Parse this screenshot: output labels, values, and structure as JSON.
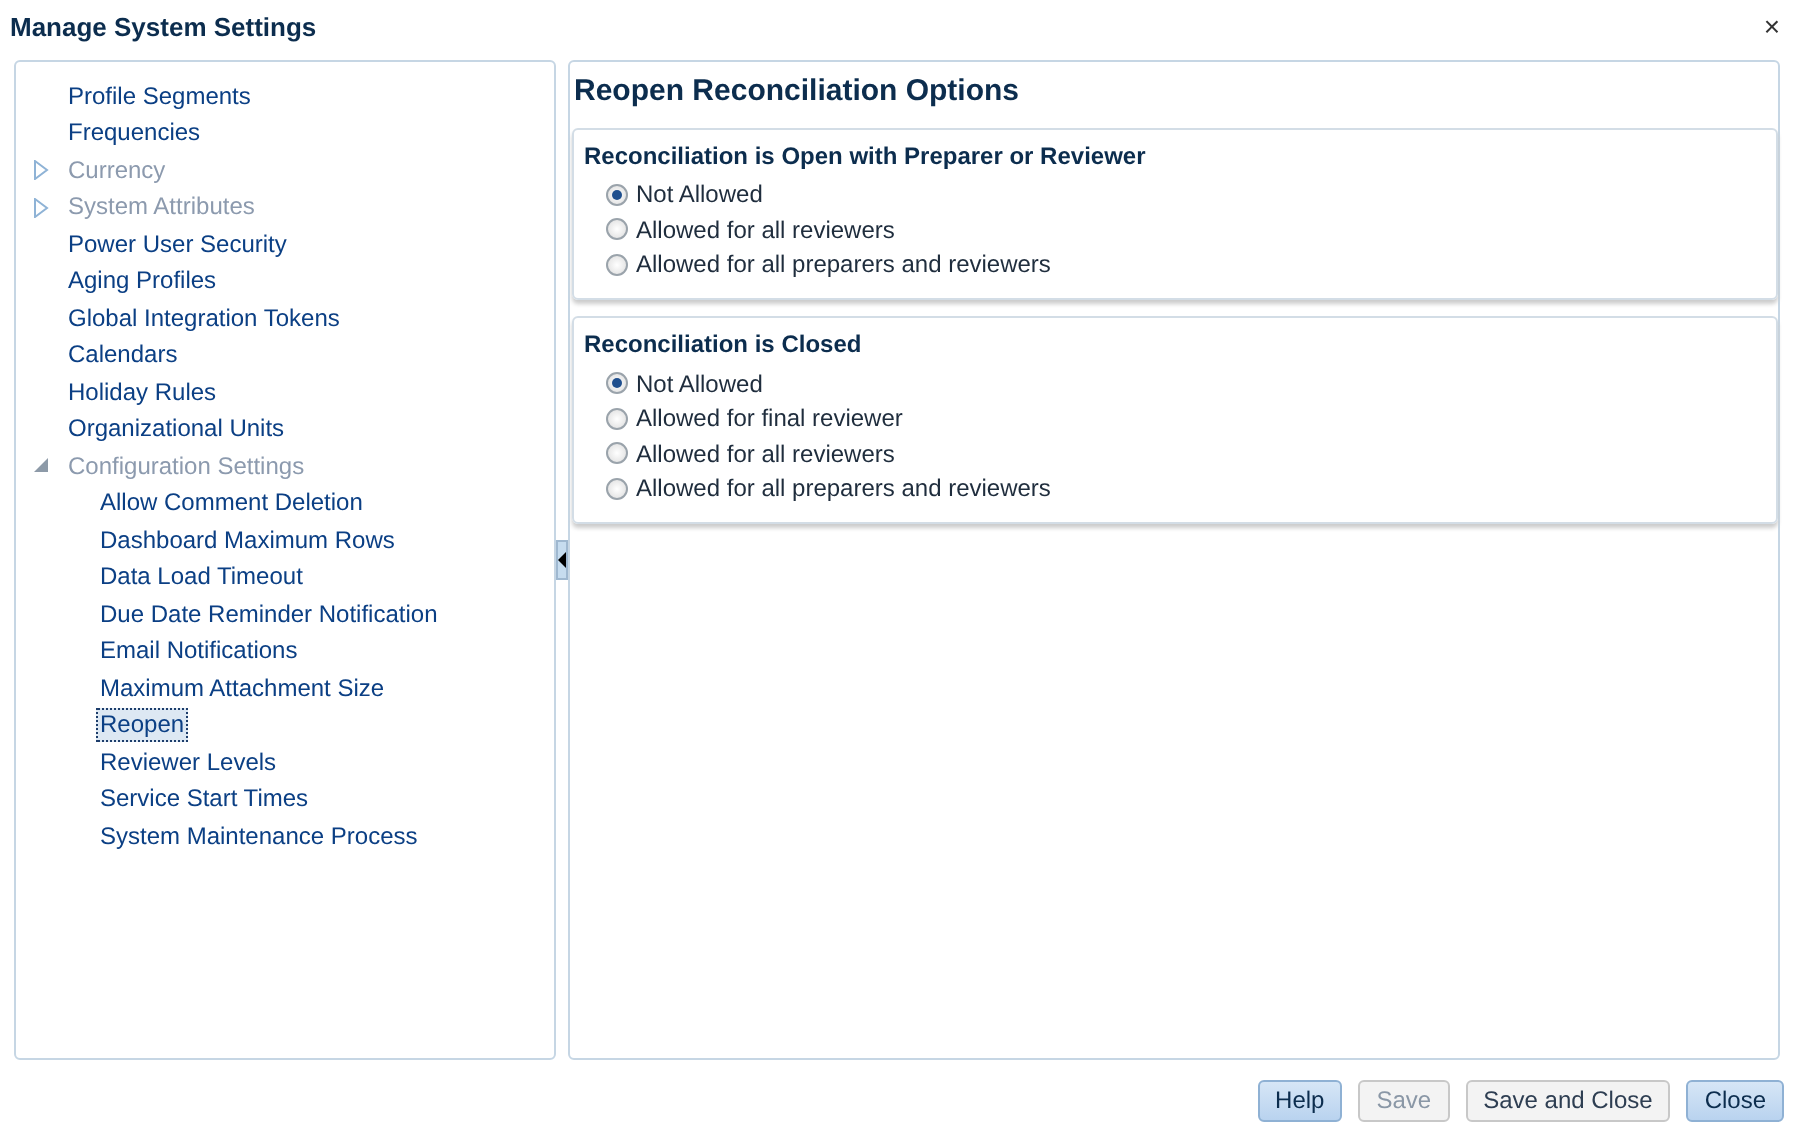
{
  "window": {
    "title": "Manage System Settings",
    "close": "×"
  },
  "tree": [
    {
      "label": "Profile Segments",
      "disabled": false,
      "selected": false
    },
    {
      "label": "Frequencies",
      "disabled": false,
      "selected": false
    },
    {
      "label": "Currency",
      "disabled": true,
      "selected": false,
      "expanded": false
    },
    {
      "label": "System Attributes",
      "disabled": true,
      "selected": false,
      "expanded": false
    },
    {
      "label": "Power User Security",
      "disabled": false,
      "selected": false
    },
    {
      "label": "Aging Profiles",
      "disabled": false,
      "selected": false
    },
    {
      "label": "Global Integration Tokens",
      "disabled": false,
      "selected": false
    },
    {
      "label": "Calendars",
      "disabled": false,
      "selected": false
    },
    {
      "label": "Holiday Rules",
      "disabled": false,
      "selected": false
    },
    {
      "label": "Organizational Units",
      "disabled": false,
      "selected": false
    },
    {
      "label": "Configuration Settings",
      "disabled": true,
      "selected": false,
      "expanded": true,
      "children": [
        {
          "label": "Allow Comment Deletion",
          "disabled": false,
          "selected": false
        },
        {
          "label": "Dashboard Maximum Rows",
          "disabled": false,
          "selected": false
        },
        {
          "label": "Data Load Timeout",
          "disabled": false,
          "selected": false
        },
        {
          "label": "Due Date Reminder Notification",
          "disabled": false,
          "selected": false
        },
        {
          "label": "Email Notifications",
          "disabled": false,
          "selected": false
        },
        {
          "label": "Maximum Attachment Size",
          "disabled": false,
          "selected": false
        },
        {
          "label": "Reopen",
          "disabled": false,
          "selected": true
        },
        {
          "label": "Reviewer Levels",
          "disabled": false,
          "selected": false
        },
        {
          "label": "Service Start Times",
          "disabled": false,
          "selected": false
        },
        {
          "label": "System Maintenance Process",
          "disabled": false,
          "selected": false
        }
      ]
    }
  ],
  "content": {
    "title": "Reopen Reconciliation Options",
    "groups": [
      {
        "title": "Reconciliation is Open with Preparer or Reviewer",
        "options": [
          {
            "label": "Not Allowed",
            "selected": true
          },
          {
            "label": "Allowed for all reviewers",
            "selected": false
          },
          {
            "label": "Allowed for all preparers and reviewers",
            "selected": false
          }
        ]
      },
      {
        "title": "Reconciliation is Closed",
        "options": [
          {
            "label": "Not Allowed",
            "selected": true
          },
          {
            "label": "Allowed for final reviewer",
            "selected": false
          },
          {
            "label": "Allowed for all reviewers",
            "selected": false
          },
          {
            "label": "Allowed for all preparers and reviewers",
            "selected": false
          }
        ]
      }
    ]
  },
  "buttons": [
    {
      "label": "Help",
      "disabled": false,
      "primary": true
    },
    {
      "label": "Save",
      "disabled": true,
      "primary": false
    },
    {
      "label": "Save and Close",
      "disabled": false,
      "primary": false
    },
    {
      "label": "Close",
      "disabled": false,
      "primary": true
    }
  ]
}
